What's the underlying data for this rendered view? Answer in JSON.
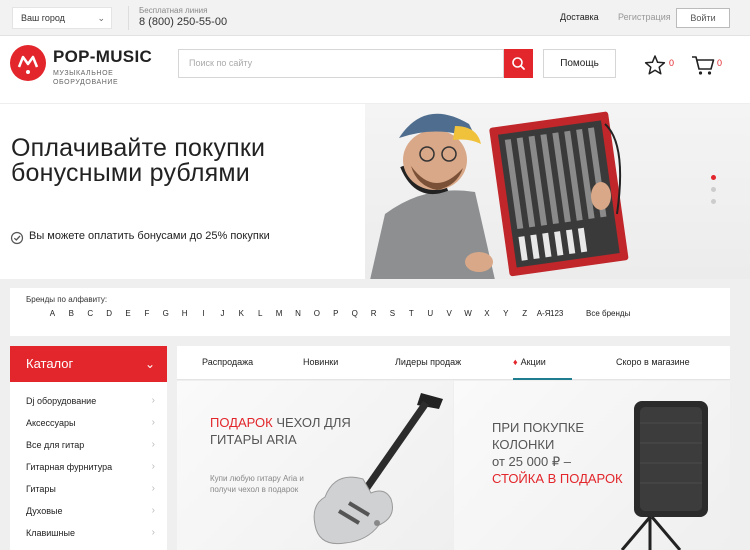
{
  "topbar": {
    "city": "Ваш город",
    "hotline_label": "Бесплатная линия",
    "hotline_phone": "8 (800) 250-55-00",
    "delivery": "Доставка",
    "register": "Регистрация",
    "login": "Войти"
  },
  "header": {
    "logo_name": "POP-MUSIC",
    "logo_tagline": "МУЗЫКАЛЬНОЕ ОБОРУДОВАНИЕ",
    "search_placeholder": "Поиск по сайту",
    "help": "Помощь",
    "fav_count": "0",
    "cart_count": "0"
  },
  "banner": {
    "title": "Оплачивайте покупки бонусными рублями",
    "note": "Вы можете оплатить бонусами до 25% покупки"
  },
  "brands": {
    "label": "Бренды по алфавиту:",
    "letters": [
      "A",
      "B",
      "C",
      "D",
      "E",
      "F",
      "G",
      "H",
      "I",
      "J",
      "K",
      "L",
      "M",
      "N",
      "O",
      "P",
      "Q",
      "R",
      "S",
      "T",
      "U",
      "V",
      "W",
      "X",
      "Y",
      "Z",
      "А-Я"
    ],
    "numeric": "123",
    "all": "Все бренды"
  },
  "catalog": {
    "title": "Каталог",
    "items": [
      "Dj оборудование",
      "Аксессуары",
      "Все для гитар",
      "Гитарная фурнитура",
      "Гитары",
      "Духовые",
      "Клавишные"
    ]
  },
  "tabs": [
    "Распродажа",
    "Новинки",
    "Лидеры продаж",
    "Акции",
    "Скоро в магазине"
  ],
  "promo1": {
    "title_red": "ПОДАРОК",
    "title_rest": "ЧЕХОЛ ДЛЯ ГИТАРЫ ARIA",
    "subtitle": "Купи любую гитару Aria и получи чехол в подарок"
  },
  "promo2": {
    "line1": "ПРИ ПОКУПКЕ КОЛОНКИ",
    "line2": "от 25 000 ₽ –",
    "line3": "СТОЙКА В ПОДАРОК"
  },
  "colors": {
    "accent": "#e2262b",
    "tab_underline": "#1f7d8f"
  }
}
